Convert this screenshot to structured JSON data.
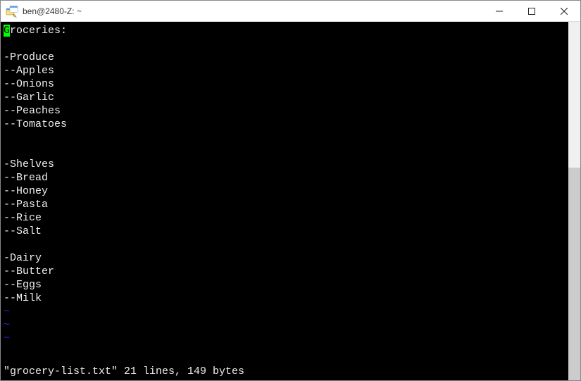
{
  "window": {
    "title": "ben@2480-Z: ~"
  },
  "editor": {
    "lines": [
      "Groceries:",
      "",
      "-Produce",
      "--Apples",
      "--Onions",
      "--Garlic",
      "--Peaches",
      "--Tomatoes",
      "",
      "",
      "-Shelves",
      "--Bread",
      "--Honey",
      "--Pasta",
      "--Rice",
      "--Salt",
      "",
      "-Dairy",
      "--Butter",
      "--Eggs",
      "--Milk"
    ],
    "cursor_char": "G",
    "rest_of_first_line": "roceries:",
    "tilde": "~",
    "status": "\"grocery-list.txt\" 21 lines, 149 bytes"
  }
}
